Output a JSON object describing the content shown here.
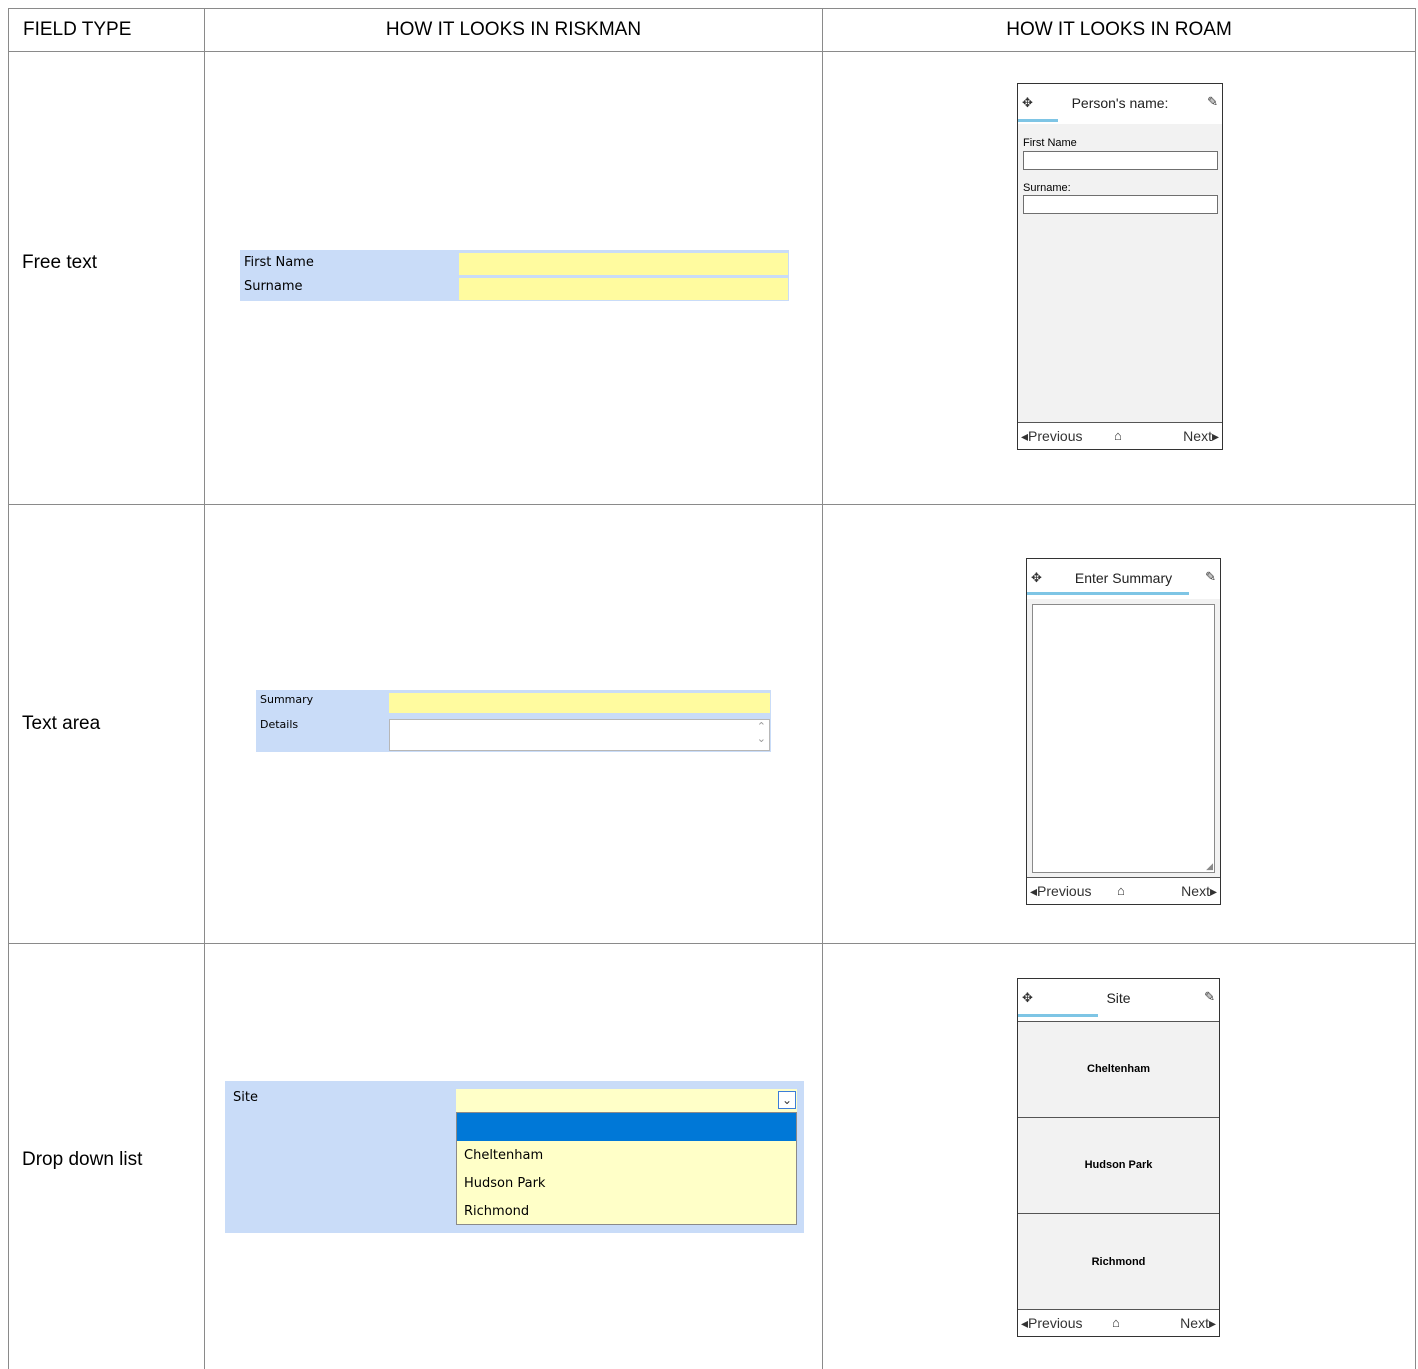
{
  "headers": {
    "field_type": "FIELD TYPE",
    "riskman": "HOW IT LOOKS IN RISKMAN",
    "roam": "HOW IT LOOKS IN ROAM"
  },
  "rows": [
    {
      "label": "Free text",
      "riskman": {
        "field1": "First Name",
        "field2": "Surname"
      },
      "roam": {
        "title": "Person's name:",
        "field1": "First Name",
        "field2": "Surname:",
        "previous": "Previous",
        "next": "Next"
      }
    },
    {
      "label": "Text area",
      "riskman": {
        "field1": "Summary",
        "field2": "Details"
      },
      "roam": {
        "title": "Enter Summary",
        "previous": "Previous",
        "next": "Next"
      }
    },
    {
      "label": "Drop down list",
      "riskman": {
        "field1": "Site",
        "options": [
          "Cheltenham",
          "Hudson Park",
          "Richmond"
        ]
      },
      "roam": {
        "title": "Site",
        "options": [
          "Cheltenham",
          "Hudson Park",
          "Richmond"
        ],
        "previous": "Previous",
        "next": "Next"
      }
    }
  ],
  "icons": {
    "phone_left": "pin-icon",
    "phone_right": "plug-icon",
    "home": "home-icon",
    "dropdown": "chevron-down-icon",
    "spin": "spinner-arrows-icon"
  },
  "colors": {
    "riskman_label_bg": "#c9dcf8",
    "riskman_input": "#fffb9f",
    "riskman_dropdown": "#ffffc8",
    "selected": "#0078d7",
    "roam_progress": "#7ec5e5"
  }
}
